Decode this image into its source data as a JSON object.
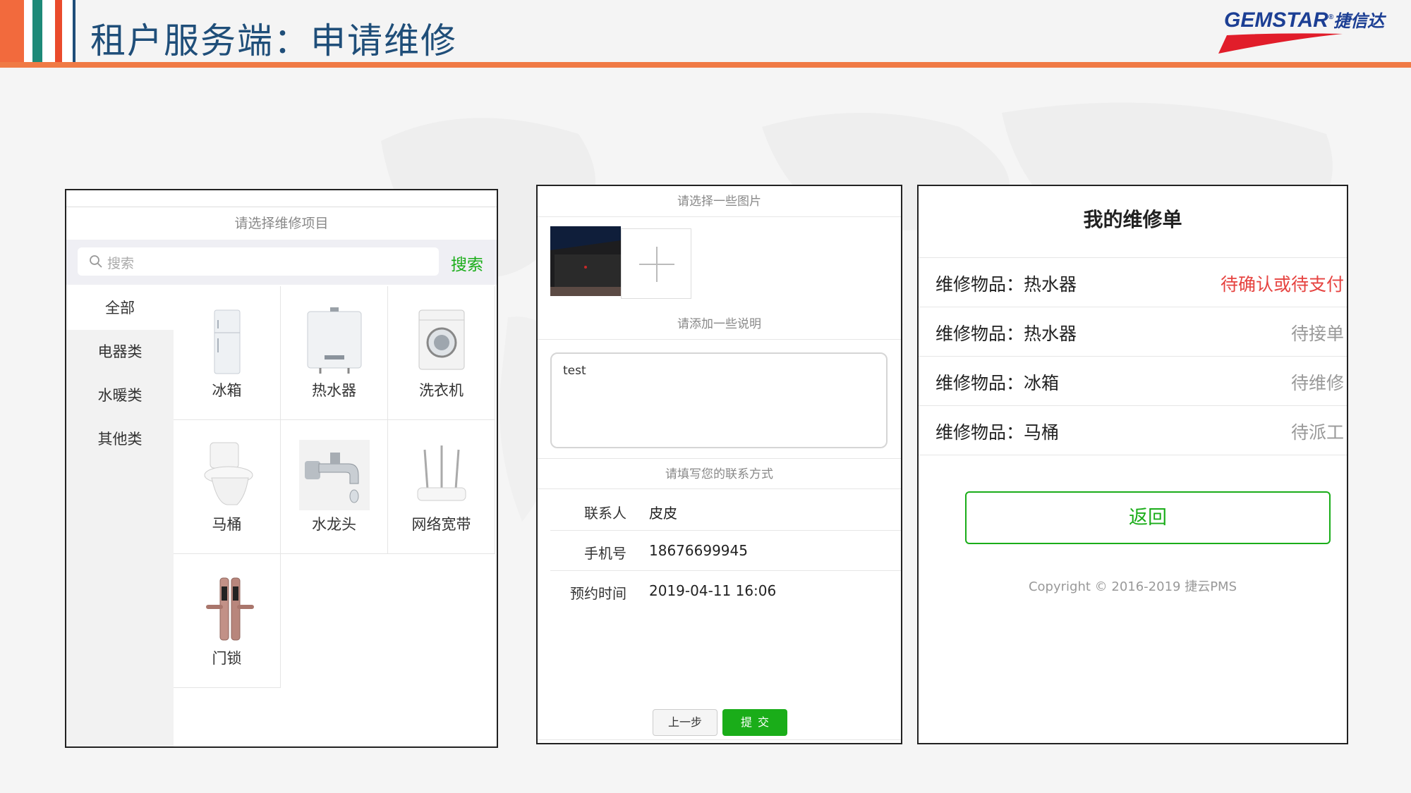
{
  "header": {
    "title": "租户服务端：申请维修",
    "logo_text": "GEMSTAR",
    "logo_cn": "捷信达"
  },
  "panel_category": {
    "header": "请选择维修项目",
    "search_placeholder": "搜索",
    "search_button": "搜索",
    "categories": [
      "全部",
      "电器类",
      "水暖类",
      "其他类"
    ],
    "items": [
      {
        "label": "冰箱",
        "icon": "refrigerator-icon"
      },
      {
        "label": "热水器",
        "icon": "water-heater-icon"
      },
      {
        "label": "洗衣机",
        "icon": "washing-machine-icon"
      },
      {
        "label": "马桶",
        "icon": "toilet-icon"
      },
      {
        "label": "水龙头",
        "icon": "faucet-icon"
      },
      {
        "label": "网络宽带",
        "icon": "router-icon"
      },
      {
        "label": "门锁",
        "icon": "door-lock-icon"
      }
    ]
  },
  "panel_form": {
    "photo_header": "请选择一些图片",
    "desc_header": "请添加一些说明",
    "desc_value": "test",
    "contact_header": "请填写您的联系方式",
    "contact_rows": [
      {
        "label": "联系人",
        "value": "皮皮"
      },
      {
        "label": "手机号",
        "value": "18676699945"
      },
      {
        "label": "预约时间",
        "value": "2019-04-11 16:06"
      }
    ],
    "prev_button": "上一步",
    "submit_button": "提交"
  },
  "panel_orders": {
    "title": "我的维修单",
    "orders": [
      {
        "item": "维修物品：热水器",
        "status": "待确认或待支付",
        "highlight": true
      },
      {
        "item": "维修物品：热水器",
        "status": "待接单",
        "highlight": false
      },
      {
        "item": "维修物品：冰箱",
        "status": "待维修",
        "highlight": false
      },
      {
        "item": "维修物品：马桶",
        "status": "待派工",
        "highlight": false
      }
    ],
    "back_button": "返回",
    "copyright": "Copyright © 2016-2019 捷云PMS"
  },
  "colors": {
    "accent_green": "#1aad19",
    "status_red": "#e64340",
    "title_blue": "#1f4e79",
    "header_orange": "#f07a45"
  }
}
